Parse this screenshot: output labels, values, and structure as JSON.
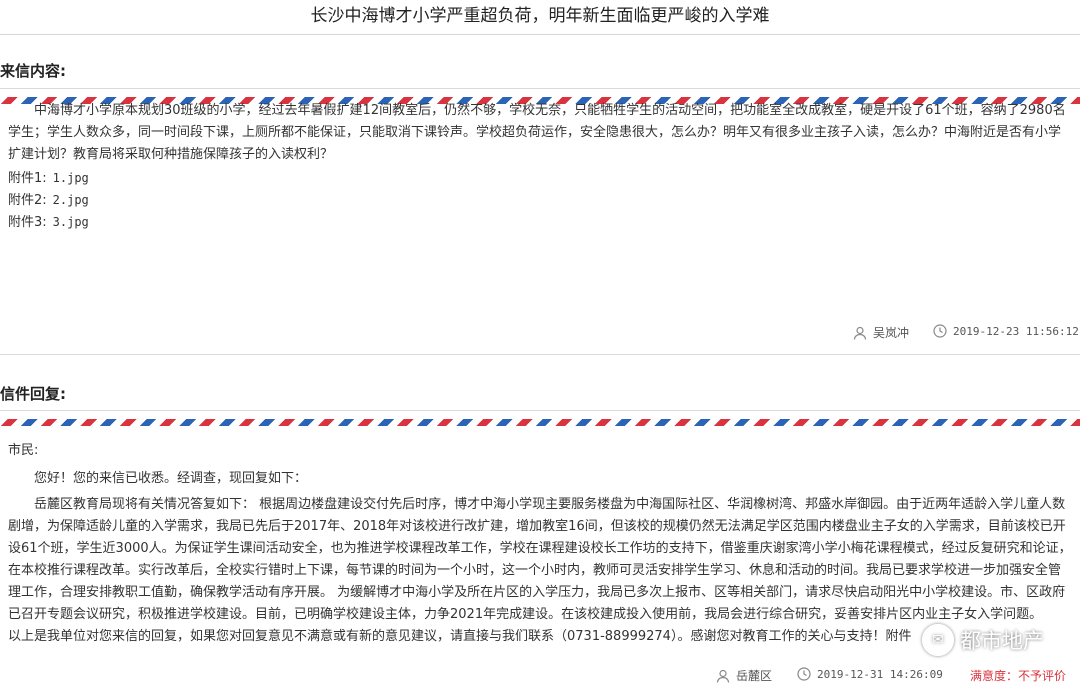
{
  "page_title": "长沙中海博才小学严重超负荷，明年新生面临更严峻的入学难",
  "incoming": {
    "label": "来信内容:",
    "body": "中海博才小学原本规划30班级的小学，经过去年暑假扩建12间教室后，仍然不够，学校无奈，只能牺牲学生的活动空间，把功能室全改成教室，硬是开设了61个班，容纳了2980名学生；学生人数众多，同一时间段下课，上厕所都不能保证，只能取消下课铃声。学校超负荷运作，安全隐患很大，怎么办？明年又有很多业主孩子入读，怎么办？中海附近是否有小学扩建计划？教育局将采取何种措施保障孩子的入读权利？",
    "attachments": [
      {
        "label": "附件1:",
        "file": "1.jpg"
      },
      {
        "label": "附件2:",
        "file": "2.jpg"
      },
      {
        "label": "附件3:",
        "file": "3.jpg"
      }
    ],
    "author": "吴岚冲",
    "datetime": "2019-12-23 11:56:12"
  },
  "reply": {
    "label": "信件回复:",
    "salutation": "市民:",
    "greeting": "您好！您的来信已收悉。经调查，现回复如下：",
    "body": "岳麓区教育局现将有关情况答复如下： 根据周边楼盘建设交付先后时序，博才中海小学现主要服务楼盘为中海国际社区、华润橡树湾、邦盛水岸御园。由于近两年适龄入学儿童人数剧增，为保障适龄儿童的入学需求，我局已先后于2017年、2018年对该校进行改扩建，增加教室16间，但该校的规模仍然无法满足学区范围内楼盘业主子女的入学需求，目前该校已开设61个班，学生近3000人。为保证学生课间活动安全，也为推进学校课程改革工作，学校在课程建设校长工作坊的支持下，借鉴重庆谢家湾小学小梅花课程模式，经过反复研究和论证，在本校推行课程改革。实行改革后，全校实行错时上下课，每节课的时间为一个小时，这一个小时内，教师可灵活安排学生学习、休息和活动的时间。我局已要求学校进一步加强安全管理工作，合理安排教职工值勤，确保教学活动有序开展。 为缓解博才中海小学及所在片区的入学压力，我局已多次上报市、区等相关部门，请求尽快启动阳光中小学校建设。市、区政府已召开专题会议研究，积极推进学校建设。目前，已明确学校建设主体，力争2021年完成建设。在该校建成投入使用前，我局会进行综合研究，妥善安排片区内业主子女入学问题。",
    "closing": "以上是我单位对您来信的回复，如果您对回复意见不满意或有新的意见建议，请直接与我们联系（0731-88999274）。感谢您对教育工作的关心与支持！附件",
    "author": "岳麓区",
    "datetime": "2019-12-31 14:26:09",
    "satisfaction": "满意度：不予评价"
  },
  "watermark": "都市地产",
  "colors": {
    "stripe_red": "#d9333f",
    "stripe_blue": "#2b64b7",
    "satisfaction": "#d9333f"
  }
}
